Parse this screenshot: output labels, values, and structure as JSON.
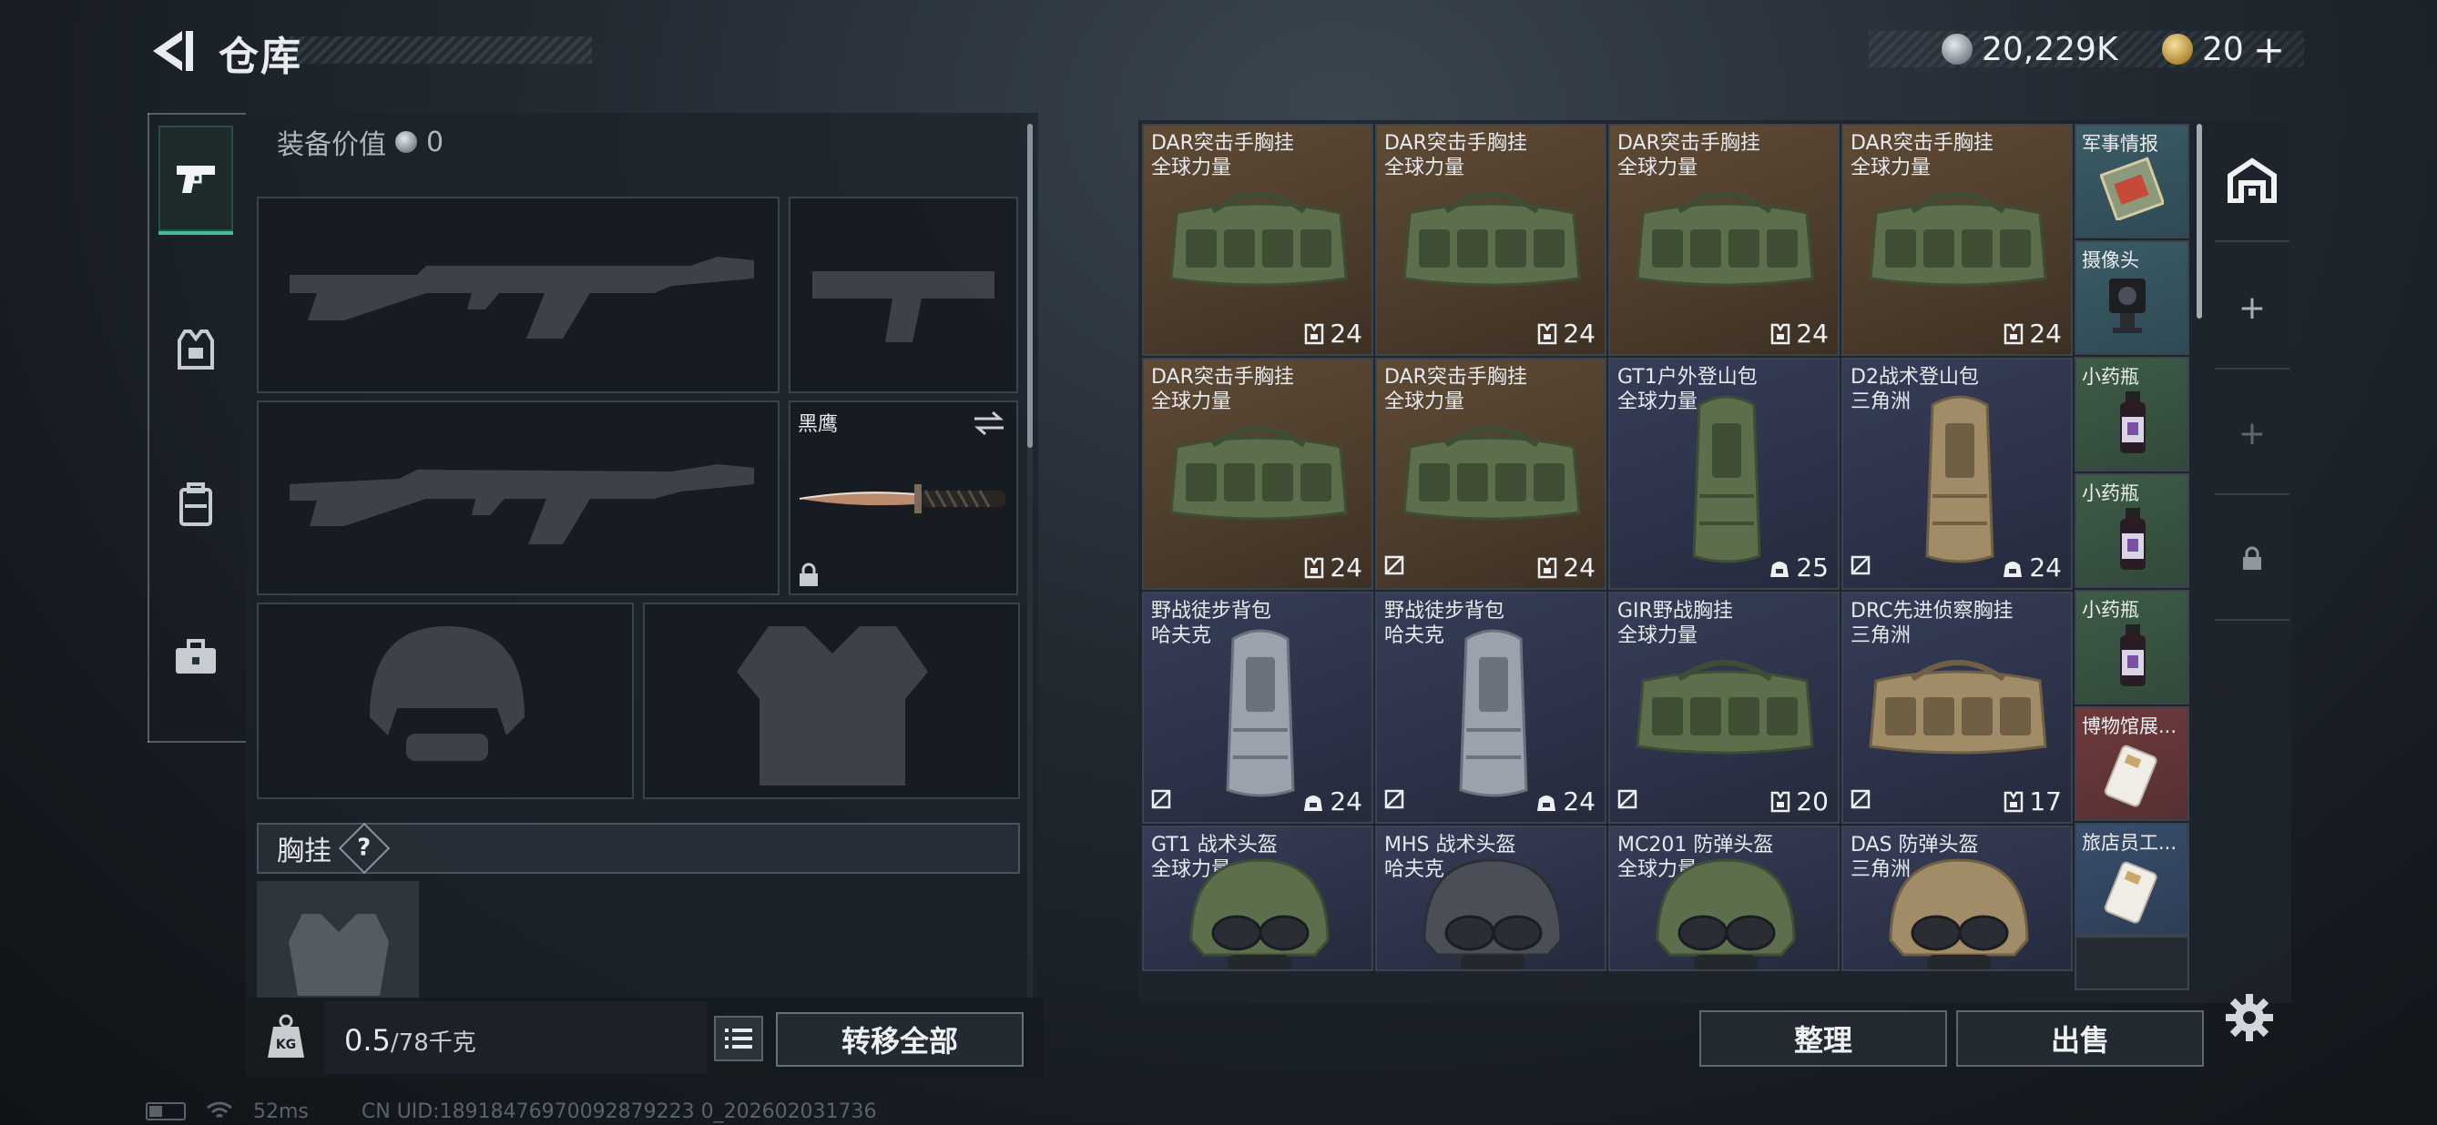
{
  "header": {
    "title": "仓库",
    "silver_amount": "20,229K",
    "gold_amount": "20",
    "add_symbol": "+"
  },
  "loadout": {
    "equip_value_label": "装备价值",
    "equip_value": "0",
    "melee_name": "黑鹰",
    "chest_label": "胸挂",
    "help_mark": "?"
  },
  "capacity": {
    "current": "0.5",
    "max_unit": "/78千克"
  },
  "buttons": {
    "transfer_all": "转移全部",
    "sort": "整理",
    "sell": "出售"
  },
  "stash": {
    "items": [
      {
        "name": "DAR突击手胸挂",
        "sub": "全球力量",
        "count": "24",
        "bg": "brown",
        "kind": "chest-rig",
        "flag": false
      },
      {
        "name": "DAR突击手胸挂",
        "sub": "全球力量",
        "count": "24",
        "bg": "brown",
        "kind": "chest-rig",
        "flag": false
      },
      {
        "name": "DAR突击手胸挂",
        "sub": "全球力量",
        "count": "24",
        "bg": "brown",
        "kind": "chest-rig",
        "flag": false
      },
      {
        "name": "DAR突击手胸挂",
        "sub": "全球力量",
        "count": "24",
        "bg": "brown",
        "kind": "chest-rig",
        "flag": false
      },
      {
        "name": "DAR突击手胸挂",
        "sub": "全球力量",
        "count": "24",
        "bg": "brown",
        "kind": "chest-rig",
        "flag": false
      },
      {
        "name": "DAR突击手胸挂",
        "sub": "全球力量",
        "count": "24",
        "bg": "brown",
        "kind": "chest-rig",
        "flag": true
      },
      {
        "name": "GT1户外登山包",
        "sub": "全球力量",
        "count": "25",
        "bg": "navy",
        "kind": "backpack",
        "flag": false
      },
      {
        "name": "D2战术登山包",
        "sub": "三角洲",
        "count": "24",
        "bg": "navy",
        "kind": "backpack-tan",
        "flag": true
      },
      {
        "name": "野战徒步背包",
        "sub": "哈夫克",
        "count": "24",
        "bg": "navy",
        "kind": "backpack-grey",
        "flag": true
      },
      {
        "name": "野战徒步背包",
        "sub": "哈夫克",
        "count": "24",
        "bg": "navy",
        "kind": "backpack-grey",
        "flag": true
      },
      {
        "name": "GIR野战胸挂",
        "sub": "全球力量",
        "count": "20",
        "bg": "navy",
        "kind": "chest-rig",
        "flag": true
      },
      {
        "name": "DRC先进侦察胸挂",
        "sub": "三角洲",
        "count": "17",
        "bg": "navy",
        "kind": "chest-rig-tan",
        "flag": true
      },
      {
        "name": "GT1 战术头盔",
        "sub": "全球力量",
        "count": "",
        "bg": "navy",
        "kind": "helmet",
        "flag": false
      },
      {
        "name": "MHS 战术头盔",
        "sub": "哈夫克",
        "count": "",
        "bg": "navy",
        "kind": "helmet-dark",
        "flag": false
      },
      {
        "name": "MC201 防弹头盔",
        "sub": "全球力量",
        "count": "",
        "bg": "navy",
        "kind": "helmet",
        "flag": false
      },
      {
        "name": "DAS 防弹头盔",
        "sub": "三角洲",
        "count": "",
        "bg": "navy",
        "kind": "helmet-tan",
        "flag": false
      }
    ],
    "side_items": [
      {
        "name": "军事情报",
        "bg": "teal",
        "kind": "intel"
      },
      {
        "name": "摄像头",
        "bg": "teal",
        "kind": "camera"
      },
      {
        "name": "小药瓶",
        "bg": "green",
        "kind": "vial"
      },
      {
        "name": "小药瓶",
        "bg": "green",
        "kind": "vial"
      },
      {
        "name": "小药瓶",
        "bg": "green",
        "kind": "vial"
      },
      {
        "name": "博物馆展...",
        "bg": "red",
        "kind": "card"
      },
      {
        "name": "旅店员工...",
        "bg": "blue",
        "kind": "card"
      }
    ]
  },
  "status": {
    "ping": "52ms",
    "uid": "CN UID:18918476970092879223 0_202602031736"
  },
  "colors": {
    "accent": "#3fbf96",
    "cell_brown": "#5e4b36",
    "cell_navy": "#363d57"
  }
}
